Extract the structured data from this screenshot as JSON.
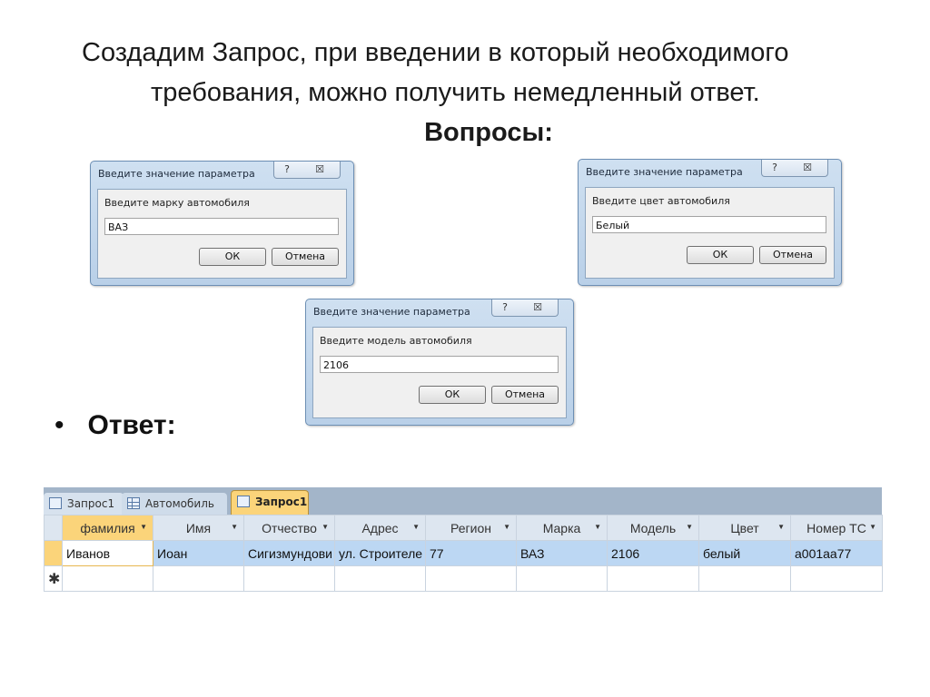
{
  "heading": {
    "line1": "Создадим Запрос, при введении в который необходимого",
    "line2": "требования, можно получить немедленный ответ.",
    "subtitle": "Вопросы:"
  },
  "dialogs": [
    {
      "title": "Введите значение параметра",
      "prompt": "Введите марку автомобиля",
      "value": "ВАЗ",
      "ok": "ОК",
      "cancel": "Отмена",
      "help": "?",
      "close": "☒"
    },
    {
      "title": "Введите значение параметра",
      "prompt": "Введите цвет автомобиля",
      "value": "Белый",
      "ok": "ОК",
      "cancel": "Отмена",
      "help": "?",
      "close": "☒"
    },
    {
      "title": "Введите значение параметра",
      "prompt": "Введите модель автомобиля",
      "value": "2106",
      "ok": "ОК",
      "cancel": "Отмена",
      "help": "?",
      "close": "☒"
    }
  ],
  "answer": {
    "bullet": "•",
    "label": "Ответ:"
  },
  "tabs": [
    {
      "label": "Запрос1"
    },
    {
      "label": "Автомобиль"
    },
    {
      "label": "Запрос1"
    }
  ],
  "table": {
    "columns": [
      "фамилия",
      "Имя",
      "Отчество",
      "Адрес",
      "Регион",
      "Марка",
      "Модель",
      "Цвет",
      "Номер ТС"
    ],
    "row": [
      "Иванов",
      "Иоан",
      "Сигизмундови",
      "ул. Строителе",
      "77",
      "ВАЗ",
      "2106",
      "белый",
      "а001аа77"
    ],
    "new_row_marker": "✱"
  }
}
